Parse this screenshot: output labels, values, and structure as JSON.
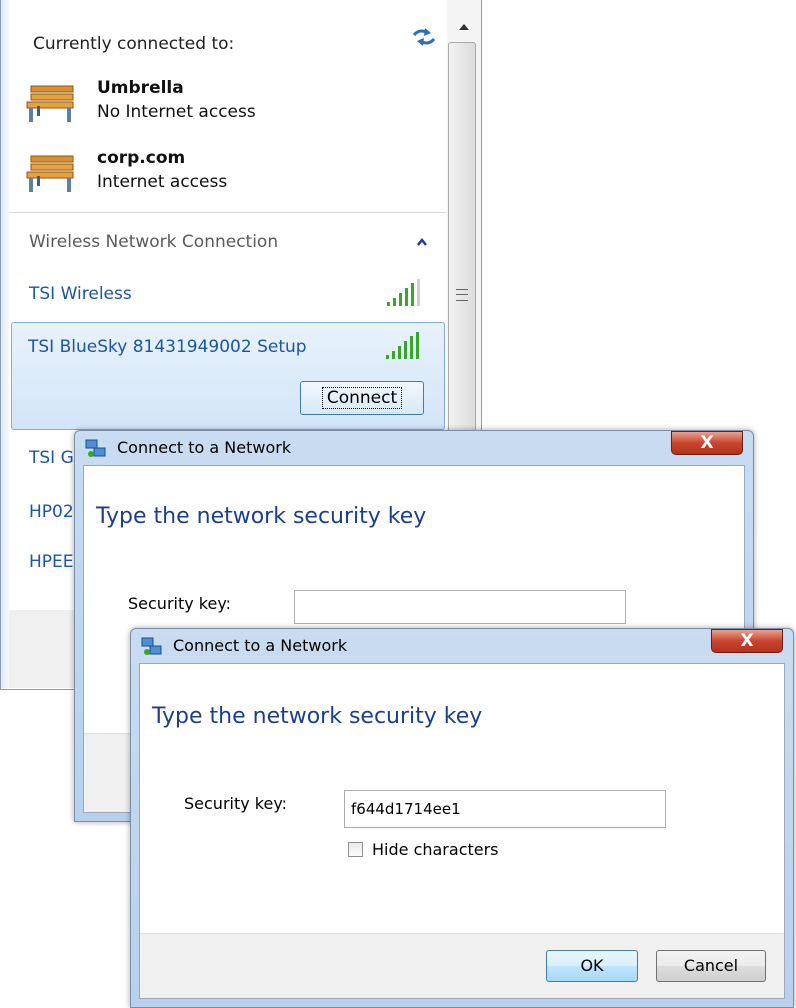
{
  "flyout": {
    "currently_connected_label": "Currently connected to:",
    "connected": [
      {
        "name": "Umbrella",
        "status": "No Internet access"
      },
      {
        "name": "corp.com",
        "status": "Internet access"
      }
    ],
    "section_title": "Wireless Network Connection",
    "networks": [
      {
        "name": "TSI Wireless"
      },
      {
        "name": "TSI BlueSky 81431949002 Setup",
        "selected": true
      },
      {
        "name": "TSI Gu"
      },
      {
        "name": "HP02"
      },
      {
        "name": "HPEE"
      }
    ],
    "connect_label": "Connect"
  },
  "dialog_back": {
    "title": "Connect to a Network",
    "close": "X",
    "heading": "Type the network security key",
    "key_label": "Security key:",
    "key_value": ""
  },
  "dialog_front": {
    "title": "Connect to a Network",
    "close": "X",
    "heading": "Type the network security key",
    "key_label": "Security key:",
    "key_value": "f644d1714ee1",
    "hide_characters_label": "Hide characters",
    "hide_characters_checked": false,
    "ok_label": "OK",
    "cancel_label": "Cancel"
  },
  "colors": {
    "link_blue": "#1a55a8",
    "heading_blue": "#1b3f8f",
    "signal_green": "#3aa52a",
    "close_red": "#c9452f"
  },
  "icons": [
    "refresh-icon",
    "bench-icon",
    "collapse-icon",
    "signal-strength-icon",
    "network-dialog-icon",
    "scroll-up-icon"
  ]
}
